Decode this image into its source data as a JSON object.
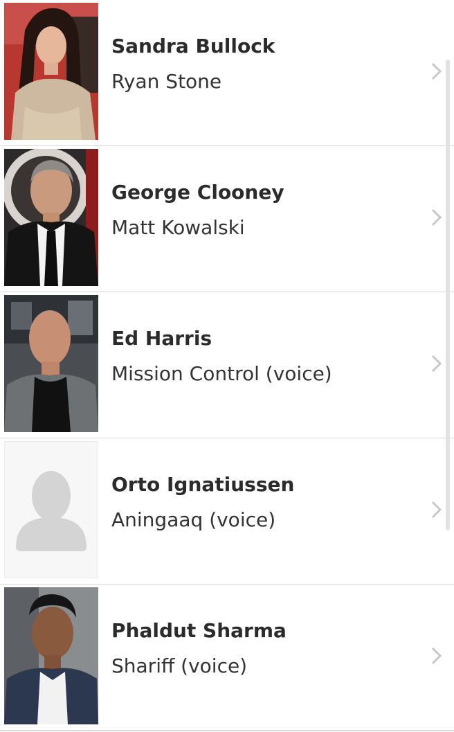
{
  "cast": [
    {
      "actor": "Sandra Bullock",
      "character": "Ryan Stone",
      "photo": "sandra-bullock-photo"
    },
    {
      "actor": "George Clooney",
      "character": "Matt Kowalski",
      "photo": "george-clooney-photo"
    },
    {
      "actor": "Ed Harris",
      "character": "Mission Control (voice)",
      "photo": "ed-harris-photo"
    },
    {
      "actor": "Orto Ignatiussen",
      "character": "Aningaaq (voice)",
      "photo": "placeholder-avatar-icon"
    },
    {
      "actor": "Phaldut Sharma",
      "character": "Shariff (voice)",
      "photo": "phaldut-sharma-photo"
    }
  ],
  "icons": {
    "row_arrow": "chevron-right-icon"
  },
  "colors": {
    "divider": "#d9d9d9",
    "name_text": "#2b2b2b",
    "role_text": "#333333",
    "chevron": "#c8c8c8",
    "placeholder": "#d4d4d4"
  }
}
